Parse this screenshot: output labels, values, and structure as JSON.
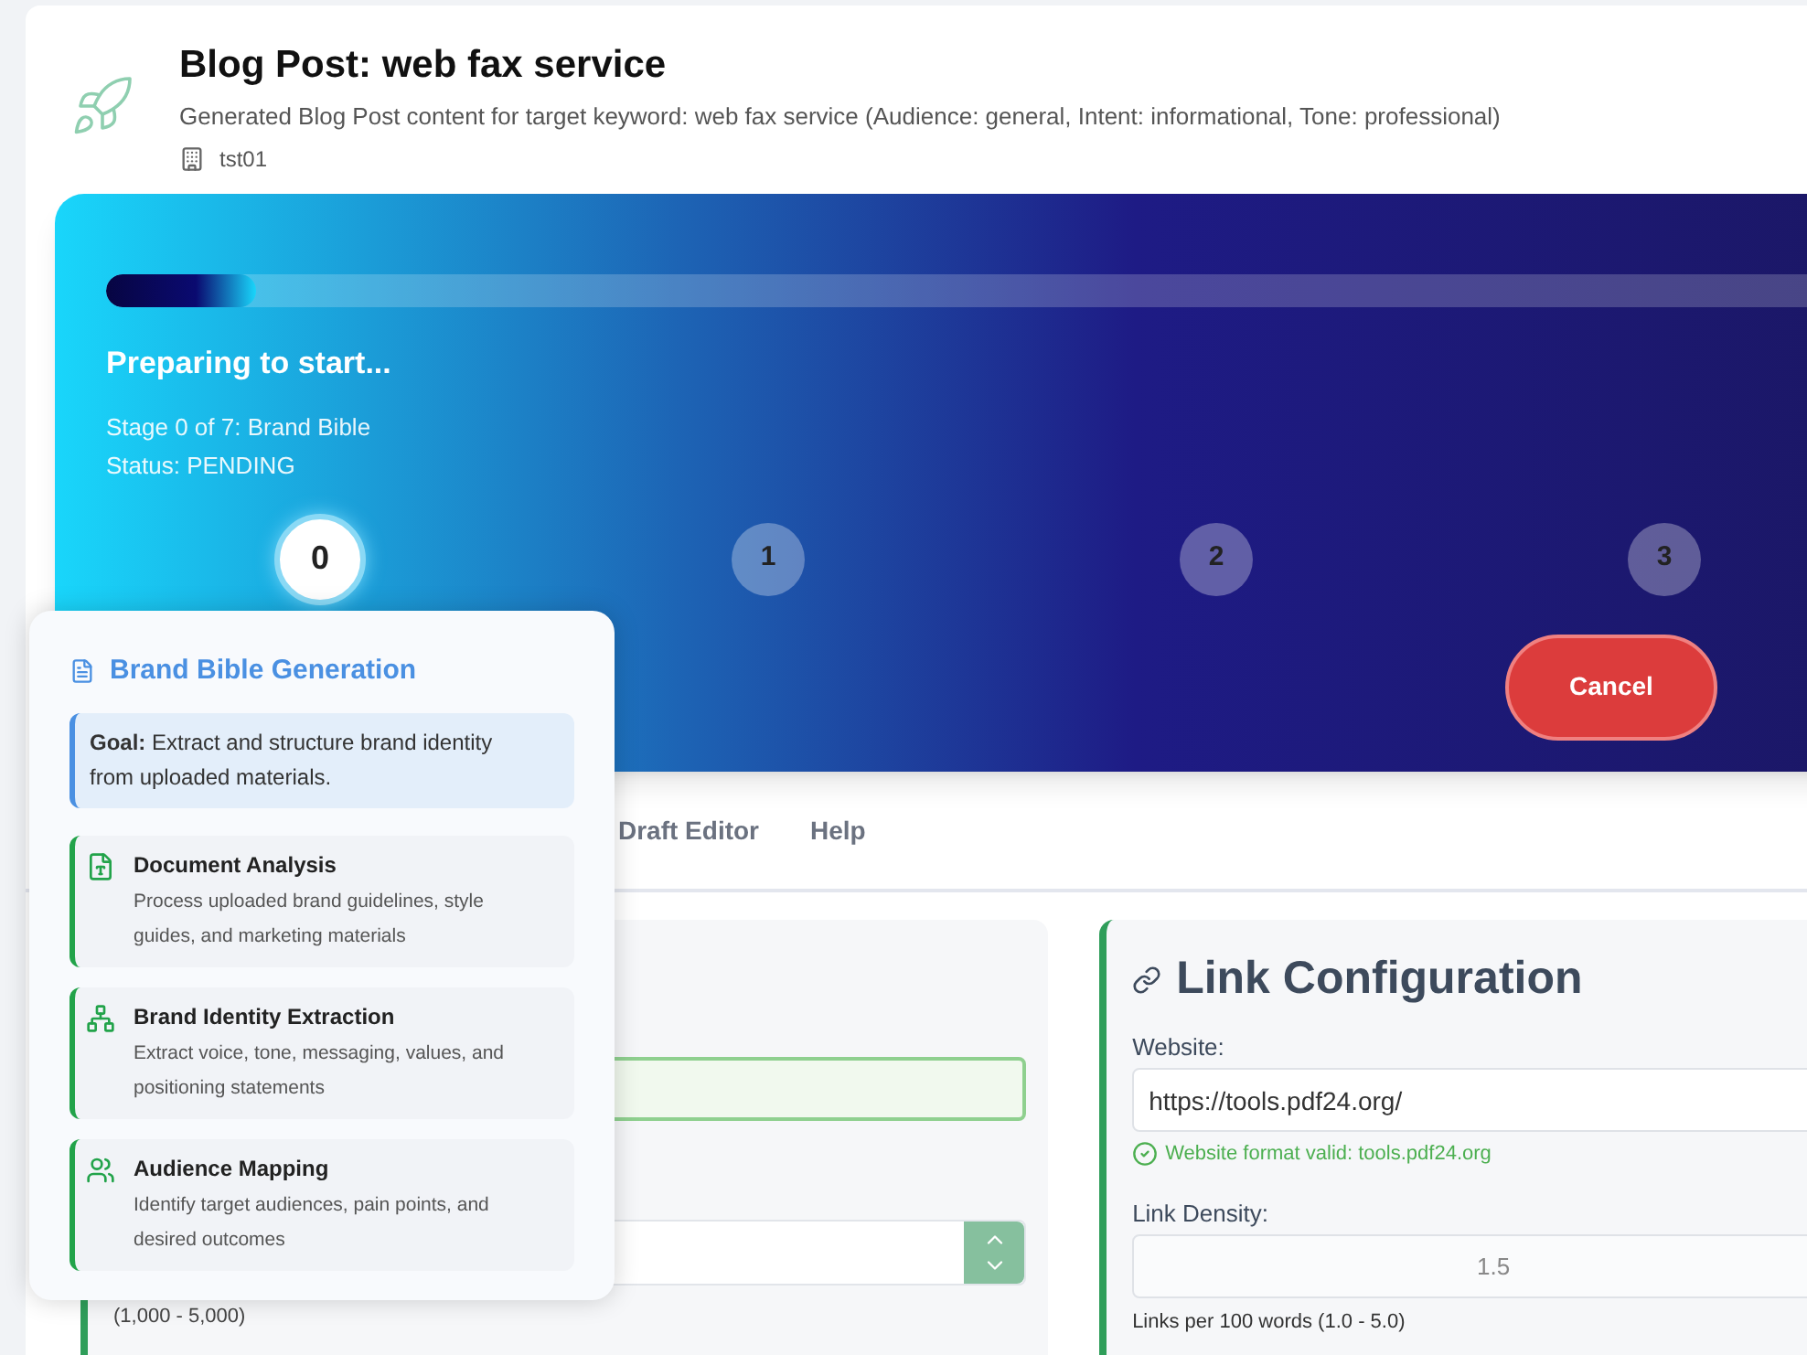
{
  "header": {
    "title": "Blog Post: web fax service",
    "subtitle": "Generated Blog Post content for target keyword: web fax service (Audience: general, Intent: informational, Tone: professional)",
    "workspace": "tst01"
  },
  "progress": {
    "level": 0.085,
    "title": "Preparing to start...",
    "stage": "Stage 0 of 7: Brand Bible",
    "status": "Status: PENDING",
    "cancel": "Cancel",
    "steps": [
      {
        "label": "0",
        "selected": true
      },
      {
        "label": "1",
        "selected": false
      },
      {
        "label": "2",
        "selected": false
      },
      {
        "label": "3",
        "selected": false
      }
    ]
  },
  "popover": {
    "title": "Brand Bible Generation",
    "goal": "**Goal:** Extract and structure brand identity from uploaded materials.",
    "tasks": [
      {
        "kind": "document",
        "title": "Document Analysis",
        "description": "Process uploaded brand guidelines, style guides, and marketing materials"
      },
      {
        "kind": "hierarchy",
        "title": "Brand Identity Extraction",
        "description": "Extract voice, tone, messaging, values, and positioning statements"
      },
      {
        "kind": "people",
        "title": "Audience Mapping",
        "description": "Identify target audiences, pain points, and desired outcomes"
      }
    ]
  },
  "tabs": [
    {
      "label": "Draft Editor"
    },
    {
      "label": "Help"
    }
  ],
  "content_settings": {
    "range_hint": "(1,000 - 5,000)"
  },
  "link_configuration": {
    "title": "Link Configuration",
    "website_label": "Website:",
    "website_value": "https://tools.pdf24.org/",
    "validation": "Website format valid: tools.pdf24.org",
    "density_label": "Link Density:",
    "density_value": "1.5",
    "density_hint": "Links per 100 words (1.0 - 5.0)"
  }
}
